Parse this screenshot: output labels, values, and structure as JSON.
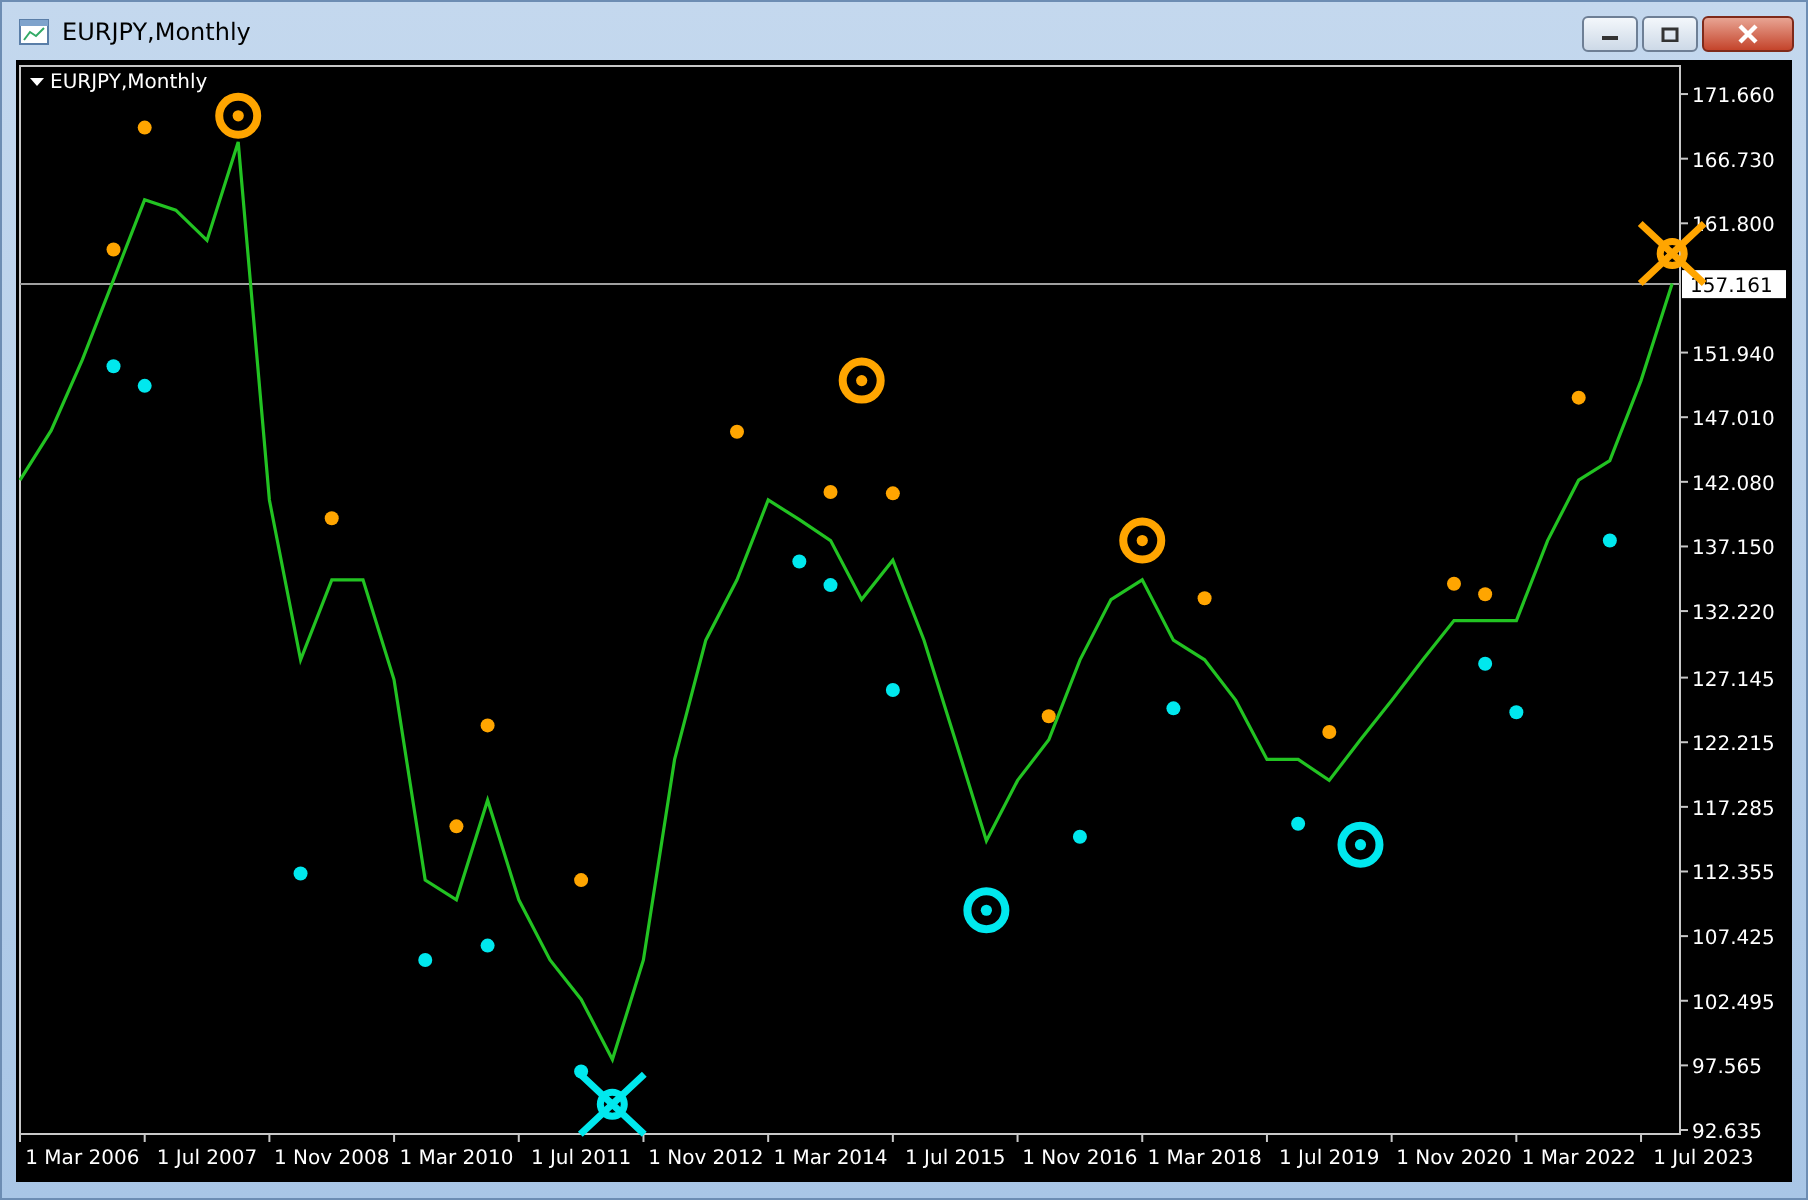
{
  "window": {
    "title": "EURJPY,Monthly"
  },
  "chart": {
    "label": "EURJPY,Monthly",
    "chart_data": {
      "type": "line",
      "categories": [
        null,
        null,
        "1 Mar 2006",
        null,
        null,
        null,
        "1 Jul 2007",
        null,
        null,
        null,
        "1 Nov 2008",
        null,
        null,
        null,
        "1 Mar 2010",
        null,
        null,
        null,
        "1 Jul 2011",
        null,
        null,
        null,
        "1 Nov 2012",
        null,
        null,
        null,
        "1 Mar 2014",
        null,
        null,
        null,
        "1 Jul 2015",
        null,
        null,
        null,
        "1 Nov 2016",
        null,
        null,
        null,
        "1 Mar 2018",
        null,
        null,
        null,
        "1 Jul 2019",
        null,
        null,
        null,
        "1 Nov 2020",
        null,
        null,
        null,
        "1 Mar 2022",
        null,
        null,
        null,
        "1 Jul 2023"
      ],
      "series": [
        {
          "color": "#22c322",
          "values": [
            142.2,
            146,
            151.4,
            157.5,
            163.6,
            162.8,
            160.5,
            168,
            140.7,
            128.5,
            134.6,
            134.6,
            127,
            111.7,
            110.2,
            117.8,
            110.2,
            105.6,
            102.6,
            98,
            105.6,
            120.9,
            130,
            134.6,
            140.7,
            139.2,
            137.6,
            133.1,
            136.1,
            130,
            122.4,
            114.7,
            119.3,
            122.4,
            128.5,
            133.1,
            134.6,
            130,
            128.5,
            125.4,
            120.9,
            120.9,
            119.3,
            122.4,
            125.4,
            128.5,
            131.5,
            131.5,
            131.5,
            137.6,
            142.2,
            143.7,
            149.8,
            157.2,
            null
          ]
        },
        {
          "type": "scatter",
          "marker": "circle",
          "color": "#ffa500",
          "values": [
            null,
            null,
            null,
            159.8,
            169.1,
            null,
            null,
            null,
            null,
            null,
            139.3,
            null,
            null,
            null,
            115.8,
            123.5,
            null,
            null,
            111.7,
            null,
            null,
            null,
            null,
            145.9,
            null,
            null,
            141.3,
            null,
            141.2,
            null,
            null,
            null,
            null,
            124.2,
            null,
            null,
            null,
            null,
            133.2,
            null,
            null,
            null,
            123,
            null,
            null,
            null,
            134.3,
            133.5,
            null,
            null,
            148.5,
            null,
            null,
            null,
            null
          ]
        },
        {
          "type": "scatter",
          "color": "#ffa500",
          "values": [
            null,
            null,
            null,
            null,
            null,
            null,
            null,
            170,
            null,
            null,
            null,
            null,
            null,
            null,
            null,
            null,
            null,
            null,
            null,
            null,
            null,
            null,
            null,
            null,
            null,
            null,
            null,
            149.8,
            null,
            null,
            null,
            null,
            null,
            null,
            null,
            null,
            137.6,
            null,
            null,
            null,
            null,
            null,
            null,
            null,
            null,
            null,
            null,
            null,
            null,
            null,
            null,
            null,
            null,
            null,
            null
          ]
        },
        {
          "type": "scatter",
          "marker": "cross",
          "color": "#ffa500",
          "values": [
            null,
            null,
            null,
            null,
            null,
            null,
            null,
            null,
            null,
            null,
            null,
            null,
            null,
            null,
            null,
            null,
            null,
            null,
            null,
            null,
            null,
            null,
            null,
            null,
            null,
            null,
            null,
            null,
            null,
            null,
            null,
            null,
            null,
            null,
            null,
            null,
            null,
            null,
            null,
            null,
            null,
            null,
            null,
            null,
            null,
            null,
            null,
            null,
            null,
            null,
            null,
            null,
            null,
            159.5,
            null
          ]
        },
        {
          "type": "scatter",
          "marker": "circle",
          "color": "#00e8ee",
          "values": [
            null,
            null,
            null,
            150.9,
            149.4,
            null,
            null,
            null,
            null,
            112.2,
            null,
            null,
            null,
            105.6,
            null,
            106.7,
            null,
            null,
            97.1,
            null,
            null,
            null,
            null,
            null,
            null,
            136,
            134.2,
            null,
            126.2,
            null,
            null,
            null,
            null,
            null,
            115,
            null,
            null,
            124.8,
            null,
            null,
            null,
            116,
            null,
            null,
            null,
            null,
            null,
            128.2,
            124.5,
            null,
            null,
            137.6,
            null,
            null,
            null
          ]
        },
        {
          "type": "scatter",
          "color": "#00e8ee",
          "values": [
            null,
            null,
            null,
            null,
            null,
            null,
            null,
            null,
            null,
            null,
            null,
            null,
            null,
            null,
            null,
            null,
            null,
            null,
            null,
            null,
            null,
            null,
            null,
            null,
            null,
            null,
            null,
            null,
            null,
            null,
            null,
            109.4,
            null,
            null,
            null,
            null,
            null,
            null,
            null,
            null,
            null,
            null,
            null,
            114.4,
            null,
            null,
            null,
            null,
            null,
            null,
            null,
            null,
            null,
            null,
            null
          ]
        },
        {
          "type": "scatter",
          "marker": "cross",
          "color": "#00e8ee",
          "values": [
            null,
            null,
            null,
            null,
            null,
            null,
            null,
            null,
            null,
            null,
            null,
            null,
            null,
            null,
            null,
            null,
            null,
            null,
            null,
            94.6,
            null,
            null,
            null,
            null,
            null,
            null,
            null,
            null,
            null,
            null,
            null,
            null,
            null,
            null,
            null,
            null,
            null,
            null,
            null,
            null,
            null,
            null,
            null,
            null,
            null,
            null,
            null,
            null,
            null,
            null,
            null,
            null,
            null,
            null,
            null
          ]
        }
      ],
      "ylim": [
        92.33,
        173.8
      ],
      "yticks": [
        {
          "value": 171.66,
          "label": "171.660"
        },
        {
          "value": 166.73,
          "label": "166.730"
        },
        {
          "value": 161.8,
          "label": "161.800"
        },
        {
          "value": 151.94,
          "label": "151.940"
        },
        {
          "value": 147.01,
          "label": "147.010"
        },
        {
          "value": 142.08,
          "label": "142.080"
        },
        {
          "value": 137.15,
          "label": "137.150"
        },
        {
          "value": 132.22,
          "label": "132.220"
        },
        {
          "value": 127.145,
          "label": "127.145"
        },
        {
          "value": 122.215,
          "label": "122.215"
        },
        {
          "value": 117.285,
          "label": "117.285"
        },
        {
          "value": 112.355,
          "label": "112.355"
        },
        {
          "value": 107.425,
          "label": "107.425"
        },
        {
          "value": 102.495,
          "label": "102.495"
        },
        {
          "value": 97.565,
          "label": "97.565"
        },
        {
          "value": 92.635,
          "label": "92.635"
        }
      ],
      "ref_lines": [
        {
          "axis": "y",
          "value": 157.161,
          "label": "157.161"
        }
      ]
    }
  }
}
